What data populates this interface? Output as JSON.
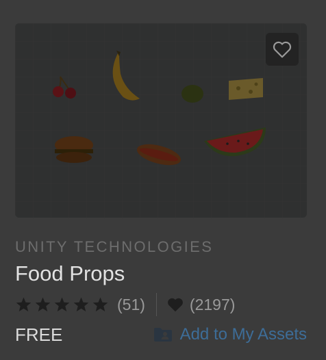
{
  "asset": {
    "publisher": "UNITY TECHNOLOGIES",
    "title": "Food Props",
    "rating_stars": 5,
    "rating_count": "(51)",
    "favorites_count": "(2197)",
    "price": "FREE",
    "add_label": "Add to My Assets"
  },
  "icons": {
    "favorite": "heart-outline-icon",
    "star": "star-icon",
    "favorites": "heart-icon",
    "add": "folder-user-icon"
  },
  "colors": {
    "background": "#3b3b3b",
    "link": "#3d6d98",
    "star": "#1e1e1e"
  }
}
